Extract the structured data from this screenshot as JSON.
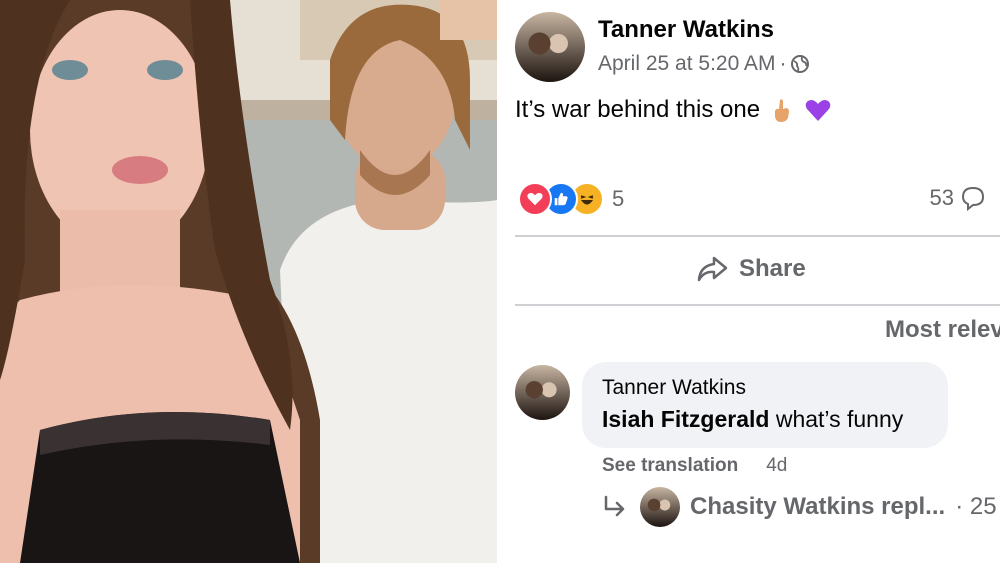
{
  "post": {
    "author": "Tanner Watkins",
    "timestamp": "April 25 at 5:20 AM",
    "separator": "·",
    "privacy_icon": "globe-icon",
    "text": "It’s war behind this one",
    "text_emojis": [
      "hand-emoji",
      "purple-heart-emoji"
    ],
    "reaction_icons": [
      "love-reaction",
      "like-reaction",
      "haha-reaction"
    ],
    "reaction_count": "5",
    "comment_count": "53",
    "share_label": "Share",
    "sort_label": "Most relev"
  },
  "comment": {
    "author": "Tanner Watkins",
    "mention": "Isiah Fitzgerald",
    "text": " what’s funny",
    "see_translation": "See translation",
    "age": "4d"
  },
  "reply": {
    "label": "Chasity Watkins repl...",
    "suffix": "· 25"
  },
  "colors": {
    "secondary_text": "#65676b",
    "bubble": "#f0f2f5",
    "divider": "#ced0d4",
    "like_blue": "#1877f2",
    "love_red": "#f33e58",
    "haha_yellow": "#f7b125"
  }
}
